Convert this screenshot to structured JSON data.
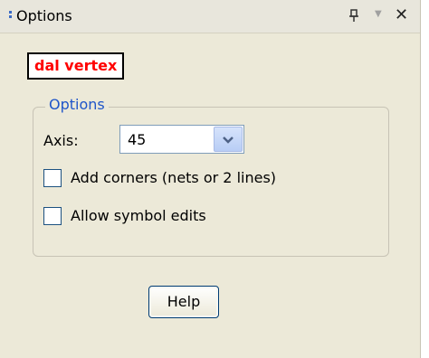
{
  "window": {
    "title": "Options",
    "pin_icon": "pin-icon",
    "dropdown_icon": "dropdown-arrow-icon",
    "close_icon": "close-icon"
  },
  "command": {
    "name": "dal vertex",
    "color": "#ff0000"
  },
  "options_group": {
    "legend": "Options",
    "axis_label": "Axis:",
    "axis_value": "45",
    "add_corners_label": "Add corners (nets or 2 lines)",
    "add_corners_checked": false,
    "allow_symbol_edits_label": "Allow symbol edits",
    "allow_symbol_edits_checked": false
  },
  "help_button": {
    "label": "Help"
  },
  "colors": {
    "panel_bg": "#ece9d8",
    "legend_text": "#1f55c9",
    "accent_border": "#003c74"
  }
}
